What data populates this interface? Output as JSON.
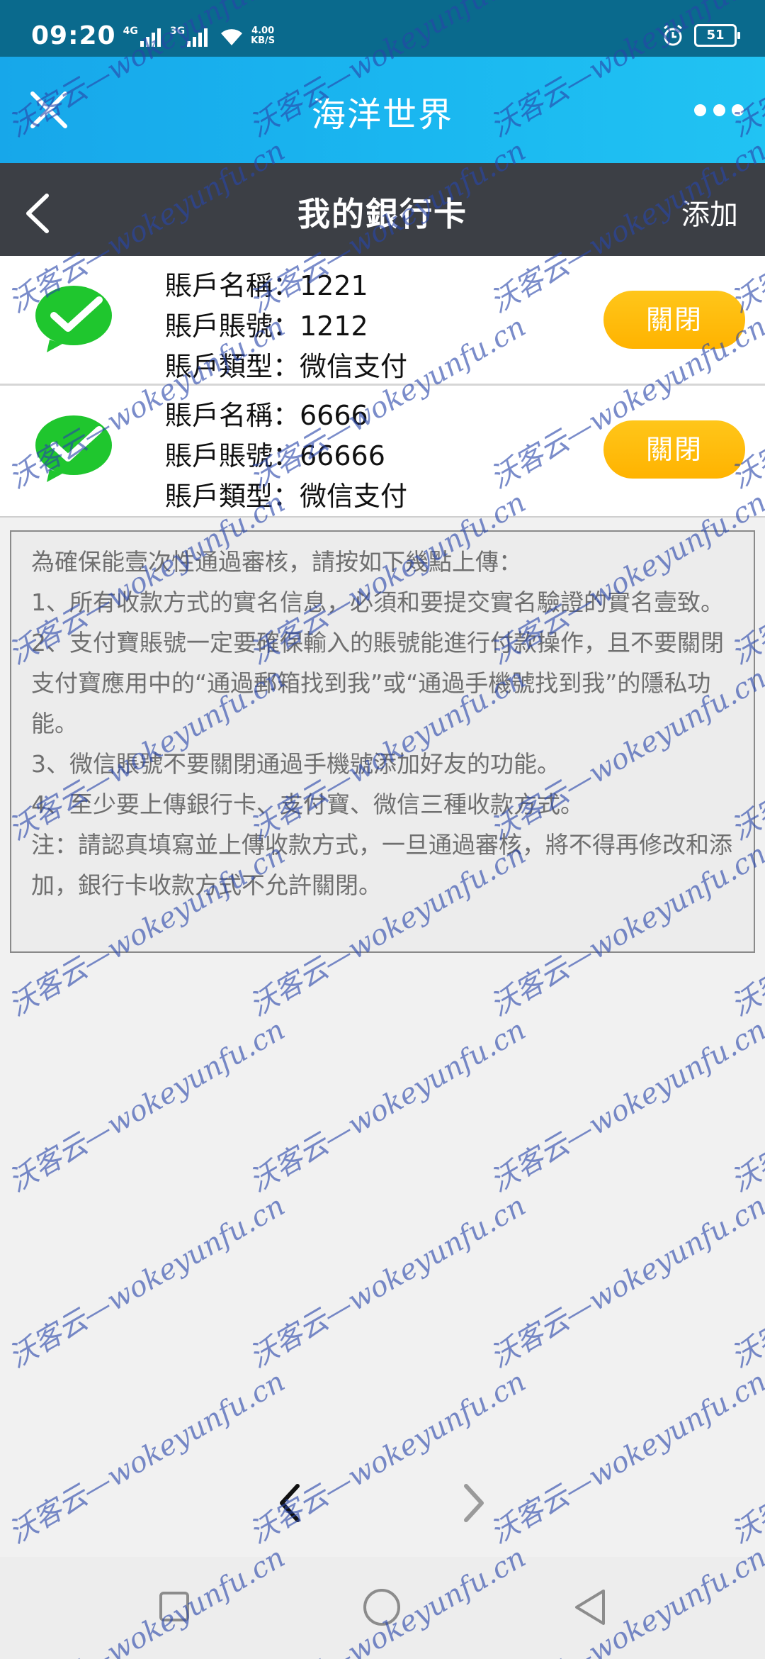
{
  "status_bar": {
    "time": "09:20",
    "network_1": "4G",
    "network_2": "3G",
    "speed_value": "4.00",
    "speed_unit": "KB/S",
    "battery": "51"
  },
  "app_bar": {
    "title": "海洋世界"
  },
  "page_header": {
    "title": "我的銀行卡",
    "add_label": "添加"
  },
  "accounts": [
    {
      "name_line": "賬戶名稱：1221",
      "number_line": "賬戶賬號：1212",
      "type_line": "賬戶類型：微信支付",
      "close_label": "關閉"
    },
    {
      "name_line": "賬戶名稱：6666",
      "number_line": "賬戶賬號：66666",
      "type_line": "賬戶類型：微信支付",
      "close_label": "關閉"
    }
  ],
  "notice": {
    "lines": [
      "為確保能壹次性通過審核，請按如下幾點上傳：",
      "1、所有收款方式的實名信息，必須和要提交實名驗證的實名壹致。",
      "2、支付寶賬號一定要確保輸入的賬號能進行付款操作，且不要關閉支付寶應用中的“通過郵箱找到我”或“通過手機號找到我”的隱私功能。",
      "3、微信賬號不要關閉通過手機號添加好友的功能。",
      "4、至少要上傳銀行卡、支付寶、微信三種收款方式。",
      "注：請認真填寫並上傳收款方式，一旦通過審核，將不得再修改和添加，銀行卡收款方式不允許關閉。"
    ]
  },
  "watermark": {
    "text": "沃客云—wokeyunfu.cn"
  }
}
